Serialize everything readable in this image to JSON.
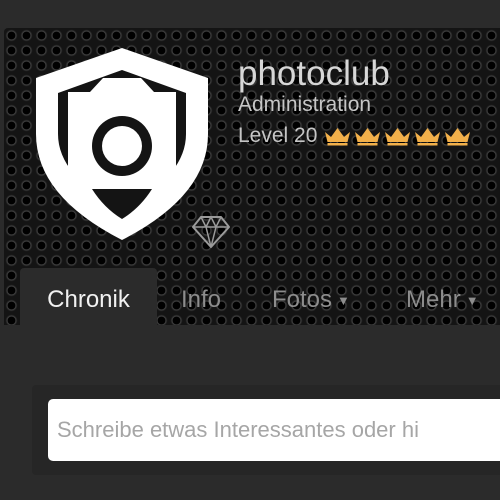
{
  "profile": {
    "name": "photoclub",
    "role": "Administration",
    "level_label": "Level 20",
    "crown_count": 5,
    "icons": {
      "logo": "camera-shield-icon",
      "rank": "crown-icon",
      "badge": "diamond-icon"
    }
  },
  "tabs": [
    {
      "label": "Chronik",
      "active": true
    },
    {
      "label": "Info"
    },
    {
      "label": "Fotos",
      "has_dropdown": true
    },
    {
      "label": "Mehr",
      "has_dropdown": true
    }
  ],
  "composer": {
    "placeholder": "Schreibe etwas Interessantes oder hi"
  },
  "colors": {
    "page_background": "#2b2b2b",
    "crown": "#f2b04a",
    "logo": "#ffffff",
    "input_background": "#ffffff"
  }
}
